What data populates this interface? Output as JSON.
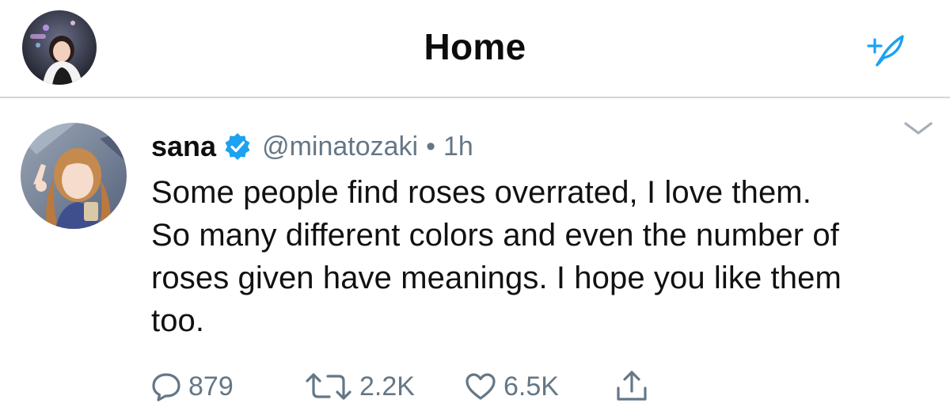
{
  "header": {
    "title": "Home",
    "compose_icon": "compose-feather-icon"
  },
  "tweet": {
    "display_name": "sana",
    "verified_icon": "verified-badge-icon",
    "handle": "@minatozaki",
    "separator": "•",
    "time": "1h",
    "text_lines": [
      "Some people find roses overrated, I love them.",
      "So many different colors and even the number of",
      "roses given have meanings. I hope you like them",
      "too."
    ],
    "menu_icon": "chevron-down-icon"
  },
  "actions": {
    "reply": {
      "icon": "reply-bubble-icon",
      "count": "879"
    },
    "retweet": {
      "icon": "retweet-icon",
      "count": "2.2K"
    },
    "like": {
      "icon": "heart-icon",
      "count": "6.5K"
    },
    "share": {
      "icon": "share-icon"
    }
  },
  "colors": {
    "accent": "#1da1f2",
    "muted_text": "#657786",
    "divider": "#d9d2d6"
  }
}
